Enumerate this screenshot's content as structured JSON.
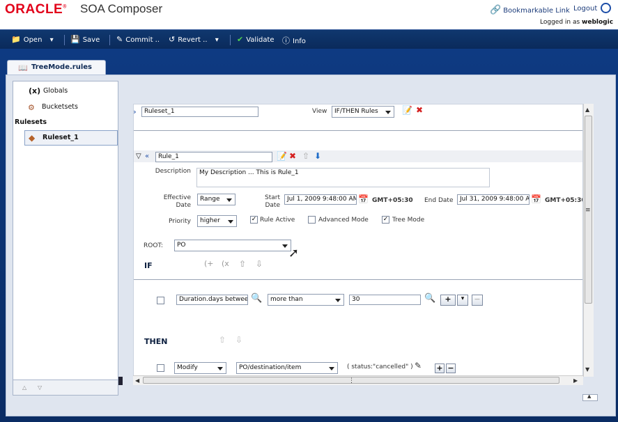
{
  "header": {
    "logo": "ORACLE",
    "logo_mark": "®",
    "app_title": "SOA Composer",
    "bookmarkable_link": "Bookmarkable Link",
    "logout": "Logout",
    "logged_in_prefix": "Logged in as",
    "user": "weblogic"
  },
  "toolbar": {
    "open": "Open",
    "save": "Save",
    "commit": "Commit ..",
    "revert": "Revert ..",
    "validate": "Validate",
    "info": "Info"
  },
  "tab": {
    "label": "TreeMode.rules"
  },
  "navigator": {
    "globals_symbol": "(x)",
    "globals": "Globals",
    "bucketsets": "Bucketsets",
    "rulesets_header": "Rulesets",
    "ruleset": "Ruleset_1"
  },
  "ruleset": {
    "name": "Ruleset_1",
    "view_label": "View",
    "view_value": "IF/THEN Rules"
  },
  "rule": {
    "name": "Rule_1",
    "description_label": "Description",
    "description": "My Description ... This is Rule_1",
    "effective_date_label": "Effective Date",
    "effective_date_value": "Range",
    "start_date_label": "Start Date",
    "start_date": "Jul 1, 2009 9:48:00 AM",
    "end_date_label": "End Date",
    "end_date": "Jul 31, 2009 9:48:00 A",
    "timezone": "GMT+05:30",
    "priority_label": "Priority",
    "priority_value": "higher",
    "rule_active": "Rule Active",
    "advanced_mode": "Advanced Mode",
    "tree_mode": "Tree Mode",
    "root_label": "ROOT:",
    "root_value": "PO"
  },
  "if_section": {
    "label": "IF",
    "condition_left": "Duration.days betwee",
    "operator": "more than",
    "value": "30"
  },
  "then_section": {
    "label": "THEN",
    "action": "Modify",
    "target": "PO/destination/item",
    "expression": "( status:\"cancelled\" )"
  },
  "icons": {
    "search": "magnifier-icon",
    "calendar": "calendar-icon",
    "delete_color": "#d42020",
    "add_color": "#1e6cc8"
  }
}
